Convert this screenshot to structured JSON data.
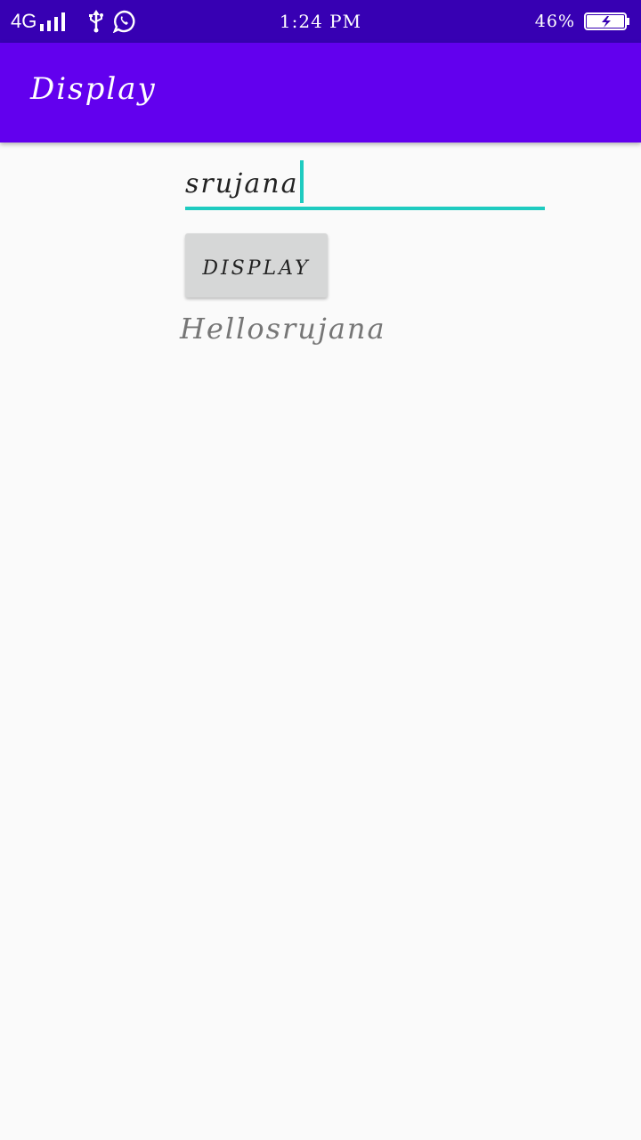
{
  "status_bar": {
    "network": "4G",
    "time": "1:24 PM",
    "battery_percent": "46%",
    "icons": [
      "signal-icon",
      "usb-icon",
      "whatsapp-icon",
      "battery-charging-icon"
    ],
    "background": "#3700b3"
  },
  "app_bar": {
    "title": "Display",
    "background": "#6200ee"
  },
  "form": {
    "name_value": "srujana",
    "button_label": "DISPLAY",
    "accent": "#1ecbc0"
  },
  "output": {
    "greeting": "Hellosrujana"
  }
}
